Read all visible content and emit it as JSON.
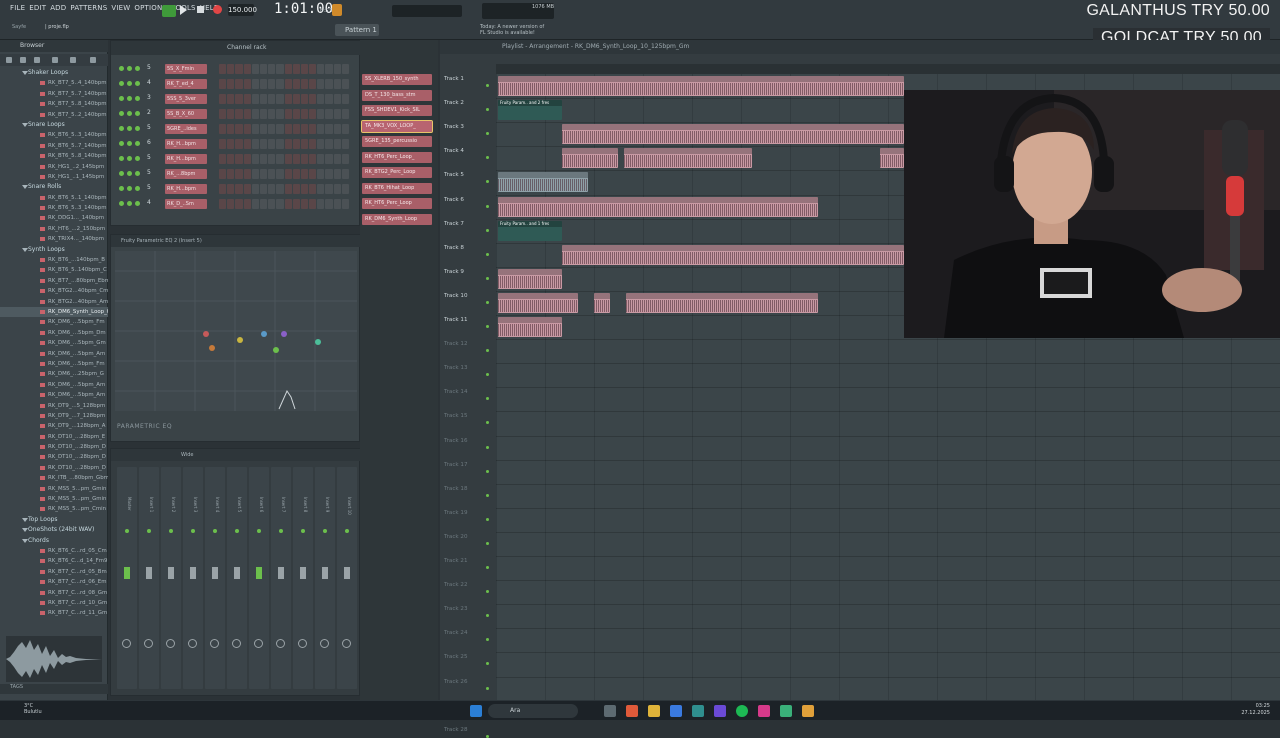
{
  "menu": [
    "FILE",
    "EDIT",
    "ADD",
    "PATTERNS",
    "VIEW",
    "OPTIONS",
    "TOOLS",
    "HELP"
  ],
  "transport": {
    "tempo": "150.000",
    "time": "1:01:00",
    "bst": "B:S:T",
    "pattern": "Pattern 1",
    "cpu_text": "1076 MB"
  },
  "hint": {
    "name": "Sayfe",
    "value": "| proje.flp"
  },
  "news": {
    "line1": "Today: A newer version of",
    "line2": "FL Studio is available!"
  },
  "donations": [
    {
      "text": "GALANTHUS  TRY 50.00"
    },
    {
      "text": "GOLDCAT  TRY 50.00"
    }
  ],
  "browser": {
    "title": "Browser",
    "tags": "TAGS",
    "tree": [
      {
        "t": "folder",
        "label": "Shaker Loops"
      },
      {
        "t": "item",
        "label": "RK_BT7_5..4_140bpm"
      },
      {
        "t": "item",
        "label": "RK_BT7_5..7_140bpm"
      },
      {
        "t": "item",
        "label": "RK_BT7_5..8_140bpm"
      },
      {
        "t": "item",
        "label": "RK_BT7_5..2_140bpm"
      },
      {
        "t": "folder",
        "label": "Snare Loops"
      },
      {
        "t": "item",
        "label": "RK_BT6_5..3_140bpm"
      },
      {
        "t": "item",
        "label": "RK_BT6_5..7_140bpm"
      },
      {
        "t": "item",
        "label": "RK_BT6_5..8_140bpm"
      },
      {
        "t": "item",
        "label": "RK_HG1_..2_145bpm"
      },
      {
        "t": "item",
        "label": "RK_HG1_..1_145bpm"
      },
      {
        "t": "folder",
        "label": "Snare Rolls"
      },
      {
        "t": "item",
        "label": "RK_BT6_5..1_140bpm"
      },
      {
        "t": "item",
        "label": "RK_BT6_5..3_140bpm"
      },
      {
        "t": "item",
        "label": "RK_DDG1..._140bpm"
      },
      {
        "t": "item",
        "label": "RK_HT6_...2_150bpm"
      },
      {
        "t": "item",
        "label": "RK_TRIX4..._140bpm"
      },
      {
        "t": "folder",
        "label": "Synth Loops"
      },
      {
        "t": "item",
        "label": "RK_BT6_...140bpm_B"
      },
      {
        "t": "item",
        "label": "RK_BT6_5..140bpm_C"
      },
      {
        "t": "item",
        "label": "RK_BT7_...80bpm_Ebm"
      },
      {
        "t": "item",
        "label": "RK_BTG2...40bpm_Cm"
      },
      {
        "t": "item",
        "label": "RK_BTG2...40bpm_Am"
      },
      {
        "t": "item",
        "label": "RK_DM6_Synth_Loop_03_125bpm_Dm",
        "sel": true
      },
      {
        "t": "item",
        "label": "RK_DM6_...5bpm_Fm"
      },
      {
        "t": "item",
        "label": "RK_DM6_...5bpm_Dm"
      },
      {
        "t": "item",
        "label": "RK_DM6_...5bpm_Gm"
      },
      {
        "t": "item",
        "label": "RK_DM6_...5bpm_Am"
      },
      {
        "t": "item",
        "label": "RK_DM6_...5bpm_Fm"
      },
      {
        "t": "item",
        "label": "RK_DM6_...25bpm_G"
      },
      {
        "t": "item",
        "label": "RK_DM6_...5bpm_Am"
      },
      {
        "t": "item",
        "label": "RK_DM6_...5bpm_Am"
      },
      {
        "t": "item",
        "label": "RK_DT9_...5_128bpm"
      },
      {
        "t": "item",
        "label": "RK_DT9_...7_128bpm"
      },
      {
        "t": "item",
        "label": "RK_DT9_...128bpm_A"
      },
      {
        "t": "item",
        "label": "RK_DT10_...28bpm_E"
      },
      {
        "t": "item",
        "label": "RK_DT10_...28bpm_D"
      },
      {
        "t": "item",
        "label": "RK_DT10_...28bpm_D"
      },
      {
        "t": "item",
        "label": "RK_DT10_...28bpm_D"
      },
      {
        "t": "item",
        "label": "RK_ITB_...80bpm_Gbm"
      },
      {
        "t": "item",
        "label": "RK_MS5_5...pm_Gmin"
      },
      {
        "t": "item",
        "label": "RK_MS5_5...pm_Gmin"
      },
      {
        "t": "item",
        "label": "RK_MS5_5...pm_Cmin"
      },
      {
        "t": "folder",
        "label": "Top Loops"
      },
      {
        "t": "folder",
        "label": "OneShots (24bit WAV)"
      },
      {
        "t": "folder",
        "label": "Chords"
      },
      {
        "t": "item",
        "label": "RK_BT6_C...rd_05_Cm"
      },
      {
        "t": "item",
        "label": "RK_BT6_C...d_14_Fm9"
      },
      {
        "t": "item",
        "label": "RK_BT7_C...rd_05_Bm"
      },
      {
        "t": "item",
        "label": "RK_BT7_C...rd_06_Em"
      },
      {
        "t": "item",
        "label": "RK_BT7_C...rd_08_Gm"
      },
      {
        "t": "item",
        "label": "RK_BT7_C...rd_10_Gm"
      },
      {
        "t": "item",
        "label": "RK_BT7_C...rd_11_Gm"
      }
    ]
  },
  "channel_rack": {
    "title": "Channel rack",
    "channels": [
      {
        "num": "5",
        "name": "5S_X_Fmin"
      },
      {
        "num": "4",
        "name": "RK_T_ed_4"
      },
      {
        "num": "3",
        "name": "5SS_5_3ver"
      },
      {
        "num": "2",
        "name": "5S_B_X_60"
      },
      {
        "num": "5",
        "name": "5GRE_..ides"
      },
      {
        "num": "6",
        "name": "RK_H...bpm"
      },
      {
        "num": "5",
        "name": "RK_H...bpm"
      },
      {
        "num": "5",
        "name": "RK_...8bpm"
      },
      {
        "num": "5",
        "name": "RK_H...bpm"
      },
      {
        "num": "4",
        "name": "RK_D_..Sm"
      }
    ]
  },
  "eq": {
    "title": "Fruity Parametric EQ 2 (Insert 5)",
    "label": "PARAMETRIC EQ"
  },
  "mixer": {
    "title": "Wide",
    "strips": [
      "Master",
      "Insert 1",
      "Insert 2",
      "Insert 3",
      "Insert 4",
      "Insert 5",
      "Insert 6",
      "Insert 7",
      "Insert 8",
      "Insert 9",
      "Insert 10"
    ]
  },
  "picker": [
    {
      "name": "5S_XLERB_150_synth"
    },
    {
      "name": "DS_T_130_bass_stm"
    },
    {
      "name": "FSS_SHDEV1_Kick_SIL"
    },
    {
      "name": "TA_MK3_VOX_LOOP_",
      "sel": true
    },
    {
      "name": "5GRE_135_percussio"
    },
    {
      "name": "RK_HT6_Perc_Loop_"
    },
    {
      "name": "RK_BTG2_Perc_Loop"
    },
    {
      "name": "RK_BT6_Hihat_Loop"
    },
    {
      "name": "RK_HT6_Perc_Loop"
    },
    {
      "name": "RK_DM6_Synth_Loop"
    }
  ],
  "playlist": {
    "title": "Playlist - Arrangement - RK_DM6_Synth_Loop_10_125bpm_Gm",
    "tracks": [
      "Track 1",
      "Track 2",
      "Track 3",
      "Track 4",
      "Track 5",
      "Track 6",
      "Track 7",
      "Track 8",
      "Track 9",
      "Track 10",
      "Track 11",
      "Track 12",
      "Track 13",
      "Track 14",
      "Track 15",
      "Track 16",
      "Track 17",
      "Track 18",
      "Track 19",
      "Track 20",
      "Track 21",
      "Track 22",
      "Track 23",
      "Track 24",
      "Track 25",
      "Track 26",
      "Track 27",
      "Track 28"
    ],
    "auto_label": "Fruity Param.. and 2 fres",
    "auto_label2": "Fruity Param.. and 1 fres"
  },
  "taskbar": {
    "weather_temp": "3°C",
    "weather_desc": "Bulutlu",
    "search": "Ara",
    "time": "03:25",
    "date": "27.12.2025"
  },
  "colors": {
    "accent_green": "#6cbf4c",
    "clip_pink": "#c99aa4",
    "clip_grey": "#8fa1a8"
  }
}
